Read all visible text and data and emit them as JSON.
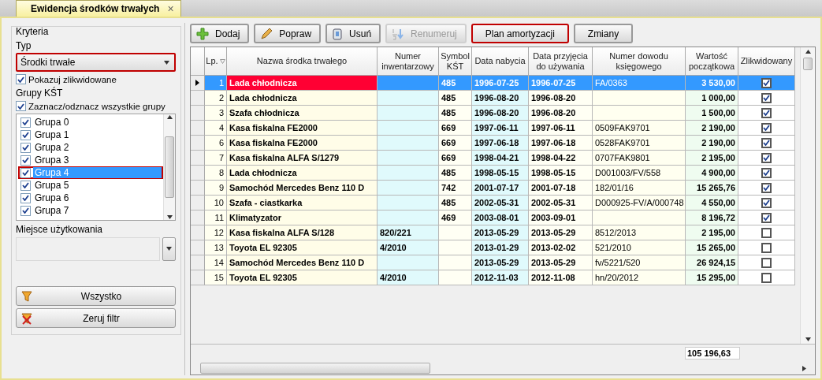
{
  "tab": {
    "title": "Ewidencja środków trwałych",
    "close": "×"
  },
  "criteria": {
    "title": "Kryteria",
    "type_label": "Typ",
    "type_value": "Środki trwałe",
    "type_highlighted": true,
    "show_liquidated": {
      "label": "Pokazuj zlikwidowane",
      "checked": true
    },
    "groups_label": "Grupy KŚT",
    "toggle_all": {
      "label": "Zaznacz/odznacz wszystkie grupy",
      "checked": true
    },
    "groups": [
      {
        "label": "Grupa 0",
        "checked": true,
        "selected": false,
        "highlighted": false
      },
      {
        "label": "Grupa 1",
        "checked": true,
        "selected": false,
        "highlighted": false
      },
      {
        "label": "Grupa 2",
        "checked": true,
        "selected": false,
        "highlighted": false
      },
      {
        "label": "Grupa 3",
        "checked": true,
        "selected": false,
        "highlighted": false
      },
      {
        "label": "Grupa 4",
        "checked": true,
        "selected": true,
        "highlighted": true
      },
      {
        "label": "Grupa 5",
        "checked": true,
        "selected": false,
        "highlighted": false
      },
      {
        "label": "Grupa 6",
        "checked": true,
        "selected": false,
        "highlighted": false
      },
      {
        "label": "Grupa 7",
        "checked": true,
        "selected": false,
        "highlighted": false
      }
    ],
    "place_label": "Miejsce użytkowania",
    "buttons": [
      {
        "label": "Wszystko",
        "kind": "filter"
      },
      {
        "label": "Zeruj filtr",
        "kind": "clear"
      }
    ]
  },
  "toolbar": [
    {
      "label": "Dodaj",
      "kind": "plus",
      "disabled": false,
      "highlighted": false
    },
    {
      "label": "Popraw",
      "kind": "pencil",
      "disabled": false,
      "highlighted": false
    },
    {
      "label": "Usuń",
      "kind": "trash",
      "disabled": false,
      "highlighted": false
    },
    {
      "label": "Renumeruj",
      "kind": "renumber",
      "disabled": true,
      "highlighted": false
    },
    {
      "label": "Plan amortyzacji",
      "kind": "text",
      "disabled": false,
      "highlighted": true
    },
    {
      "label": "Zmiany",
      "kind": "text",
      "disabled": false,
      "highlighted": false
    }
  ],
  "table": {
    "columns": [
      {
        "label": "Lp.",
        "sorted": true
      },
      {
        "label": "Nazwa środka trwałego",
        "sorted": false
      },
      {
        "label": "Numer inwentarzowy",
        "sorted": false
      },
      {
        "label": "Symbol KŚT",
        "sorted": false
      },
      {
        "label": "Data nabycia",
        "sorted": false
      },
      {
        "label": "Data przyjęcia do używania",
        "sorted": false
      },
      {
        "label": "Numer dowodu księgowego",
        "sorted": false
      },
      {
        "label": "Wartość początkowa",
        "sorted": false
      },
      {
        "label": "Zlikwidowany",
        "sorted": false
      }
    ],
    "rows": [
      {
        "lp": "1",
        "name": "Lada chłodnicza",
        "kst": "485",
        "acquired": "1996-07-25",
        "in_use": "1996-07-25",
        "document": "FA/0363",
        "value": "3 530,00",
        "liquidated": true,
        "selected": true
      },
      {
        "lp": "2",
        "name": "Lada chłodnicza",
        "kst": "485",
        "acquired": "1996-08-20",
        "in_use": "1996-08-20",
        "value": "1 000,00",
        "liquidated": true,
        "selected": false
      },
      {
        "lp": "3",
        "name": "Szafa chłodnicza",
        "kst": "485",
        "acquired": "1996-08-20",
        "in_use": "1996-08-20",
        "value": "1 500,00",
        "liquidated": true,
        "selected": false
      },
      {
        "lp": "4",
        "name": "Kasa fiskalna FE2000",
        "kst": "669",
        "acquired": "1997-06-11",
        "in_use": "1997-06-11",
        "document": "0509FAK9701",
        "value": "2 190,00",
        "liquidated": true,
        "selected": false
      },
      {
        "lp": "6",
        "name": "Kasa fiskalna FE2000",
        "kst": "669",
        "acquired": "1997-06-18",
        "in_use": "1997-06-18",
        "document": "0528FAK9701",
        "value": "2 190,00",
        "liquidated": true,
        "selected": false
      },
      {
        "lp": "7",
        "name": "Kasa fiskalna ALFA S/1279",
        "kst": "669",
        "acquired": "1998-04-21",
        "in_use": "1998-04-22",
        "document": "0707FAK9801",
        "value": "2 195,00",
        "liquidated": true,
        "selected": false
      },
      {
        "lp": "8",
        "name": "Lada chłodnicza",
        "kst": "485",
        "acquired": "1998-05-15",
        "in_use": "1998-05-15",
        "document": "D001003/FV/558",
        "value": "4 900,00",
        "liquidated": true,
        "selected": false
      },
      {
        "lp": "9",
        "name": "Samochód Mercedes Benz 110 D",
        "kst": "742",
        "acquired": "2001-07-17",
        "in_use": "2001-07-18",
        "document": "182/01/16",
        "value": "15 265,76",
        "liquidated": true,
        "selected": false
      },
      {
        "lp": "10",
        "name": "Szafa - ciastkarka",
        "kst": "485",
        "acquired": "2002-05-31",
        "in_use": "2002-05-31",
        "document": "D000925-FV/A/000748",
        "value": "4 550,00",
        "liquidated": true,
        "selected": false
      },
      {
        "lp": "11",
        "name": "Klimatyzator",
        "kst": "469",
        "acquired": "2003-08-01",
        "in_use": "2003-09-01",
        "value": "8 196,72",
        "liquidated": true,
        "selected": false
      },
      {
        "lp": "12",
        "name": "Kasa fiskalna ALFA S/128",
        "inventory": "820/221",
        "acquired": "2013-05-29",
        "in_use": "2013-05-29",
        "document": "8512/2013",
        "value": "2 195,00",
        "liquidated": false,
        "selected": false
      },
      {
        "lp": "13",
        "name": "Toyota EL 92305",
        "inventory": "4/2010",
        "acquired": "2013-01-29",
        "in_use": "2013-02-02",
        "document": "521/2010",
        "value": "15 265,00",
        "liquidated": false,
        "selected": false
      },
      {
        "lp": "14",
        "name": "Samochód Mercedes Benz 110 D",
        "acquired": "2013-05-29",
        "in_use": "2013-05-29",
        "document": "fv/5221/520",
        "value": "26 924,15",
        "liquidated": false,
        "selected": false
      },
      {
        "lp": "15",
        "name": "Toyota EL 92305",
        "inventory": "4/2010",
        "acquired": "2012-11-03",
        "in_use": "2012-11-08",
        "document": "hn/20/2012",
        "value": "15 295,00",
        "liquidated": false,
        "selected": false
      }
    ],
    "total": "105 196,63"
  }
}
